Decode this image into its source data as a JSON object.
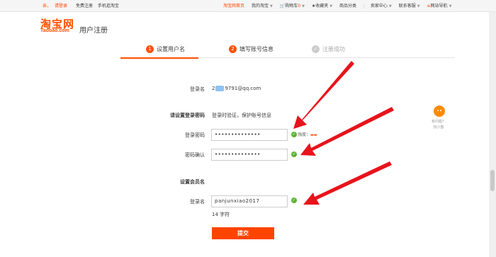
{
  "topbar": {
    "login_prefix": "亲，",
    "login_link": "请登录",
    "register": "免费注册",
    "mobile": "手机逛淘宝",
    "home": "淘宝网首页",
    "my_taobao": "我的淘宝",
    "cart": "购物车",
    "cart_count": "0",
    "favorites": "收藏夹",
    "categories": "商品分类",
    "seller_center": "卖家中心",
    "contact": "联系客服",
    "site_nav": "网站导航"
  },
  "header": {
    "logo_cn": "淘宝网",
    "logo_en": "Taobao.com",
    "title": "用户注册"
  },
  "steps": [
    {
      "num": "1",
      "label": "设置用户名"
    },
    {
      "num": "2",
      "label": "填写账号信息"
    },
    {
      "num": "✓",
      "label": "注册成功"
    }
  ],
  "form": {
    "login_label": "登录名",
    "login_prefix": "2",
    "login_suffix": "9791@qq.com",
    "pwd_section": "请设置登录密码",
    "pwd_hint": "登录时验证，保护账号信息",
    "pwd_label": "登录密码",
    "pwd_value": "••••••••••••••",
    "strength_label": "强度：",
    "confirm_label": "密码确认",
    "confirm_value": "••••••••••••••",
    "member_section": "设置会员名",
    "member_label": "登录名",
    "member_value": "panjunxiao2017",
    "char_count": "14 字符",
    "submit": "提交"
  },
  "help": {
    "line1": "有问题？",
    "line2": "找小蜜"
  },
  "colors": {
    "accent": "#ff5000",
    "success": "#5cb531",
    "arrow": "#e8131b"
  }
}
